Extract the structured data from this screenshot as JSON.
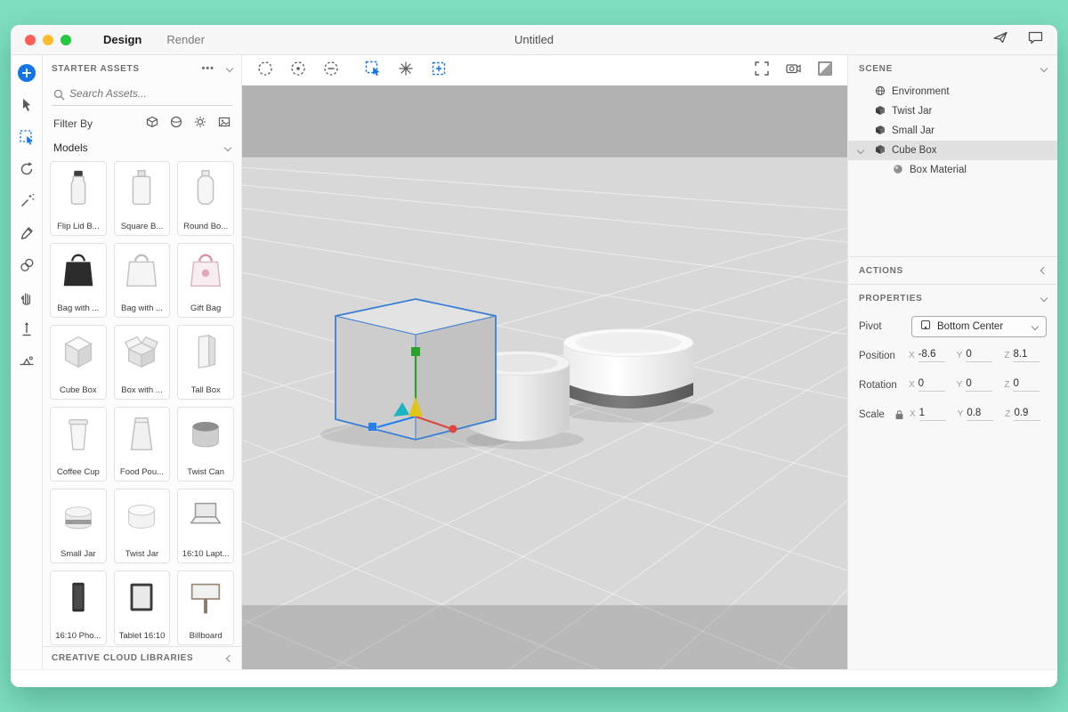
{
  "titlebar": {
    "design_tab": "Design",
    "render_tab": "Render",
    "title": "Untitled"
  },
  "icons": {
    "more": "•••"
  },
  "tools": {
    "names": [
      "add-content",
      "select",
      "region-select",
      "orbit",
      "magic-wand",
      "eyedropper",
      "sampler",
      "pan",
      "dolly",
      "horizon"
    ]
  },
  "canvas_toolbar": {
    "left_icons": [
      "orbit-camera",
      "pan-camera",
      "dolly-camera",
      "move-to-ground",
      "snap",
      "frame-selection"
    ],
    "right_icons": [
      "fit-view",
      "camera-bookmarks",
      "render-preview"
    ]
  },
  "assets_panel": {
    "header": "STARTER ASSETS",
    "search_placeholder": "Search Assets...",
    "filter_label": "Filter By",
    "filter_icons": [
      "models",
      "materials",
      "lights",
      "images"
    ],
    "models_header": "Models",
    "models": [
      "Flip Lid B...",
      "Square B...",
      "Round Bo...",
      "Bag with ...",
      "Bag with ...",
      "Gift Bag",
      "Cube Box",
      "Box with ...",
      "Tall Box",
      "Coffee Cup",
      "Food Pou...",
      "Twist Can",
      "Small Jar",
      "Twist Jar",
      "16:10 Lapt...",
      "16:10 Pho...",
      "Tablet 16:10",
      "Billboard"
    ],
    "libraries_header": "CREATIVE CLOUD LIBRARIES"
  },
  "scene_panel": {
    "header": "SCENE",
    "items": [
      {
        "label": "Environment",
        "icon": "environment-globe"
      },
      {
        "label": "Twist Jar",
        "icon": "object-cube"
      },
      {
        "label": "Small Jar",
        "icon": "object-cube"
      },
      {
        "label": "Cube Box",
        "icon": "object-cube",
        "selected": true,
        "expanded": true
      },
      {
        "label": "Box Material",
        "icon": "material-sphere",
        "child": true
      }
    ]
  },
  "actions_panel": {
    "header": "ACTIONS"
  },
  "properties_panel": {
    "header": "PROPERTIES",
    "pivot_label": "Pivot",
    "pivot_value": "Bottom Center",
    "axis": {
      "x": "X",
      "y": "Y",
      "z": "Z"
    },
    "position": {
      "label": "Position",
      "x": "-8.6",
      "y": "0",
      "z": "8.1"
    },
    "rotation": {
      "label": "Rotation",
      "x": "0",
      "y": "0",
      "z": "0"
    },
    "scale": {
      "label": "Scale",
      "locked": true,
      "x": "1",
      "y": "0.8",
      "z": "0.9"
    }
  },
  "colors": {
    "background_green": "#7EDEC1",
    "accent_blue": "#1473E6",
    "selection_outline": "#3B7FD4",
    "gizmo_x_red": "#E0453E",
    "gizmo_y_green": "#2CA02C",
    "gizmo_z_blue": "#2680EB",
    "gizmo_center_yellow": "#E2C51C"
  }
}
